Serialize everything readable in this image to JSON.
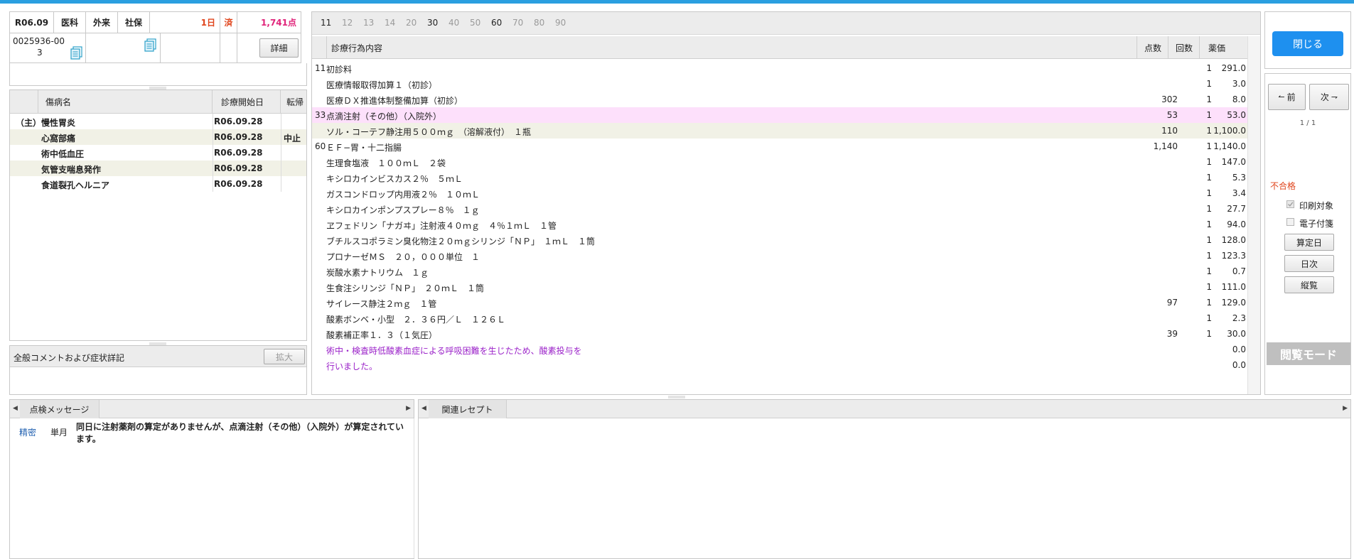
{
  "patient": {
    "era_date": "R06.09",
    "dept": "医科",
    "visit_type": "外来",
    "insurance": "社保",
    "days": "1日",
    "status": "済",
    "points": "1,741点",
    "id": "0025936-00",
    "id_suffix": "3",
    "detail_label": "詳細"
  },
  "disease_table": {
    "headers": [
      "傷病名",
      "診療開始日",
      "転帰"
    ],
    "rows": [
      {
        "mark": "（主）",
        "name": "慢性胃炎",
        "date": "R06.09.28",
        "outcome": ""
      },
      {
        "mark": "",
        "name": "心窩部痛",
        "date": "R06.09.28",
        "outcome": "中止"
      },
      {
        "mark": "",
        "name": "術中低血圧",
        "date": "R06.09.28",
        "outcome": ""
      },
      {
        "mark": "",
        "name": "気管支喘息発作",
        "date": "R06.09.28",
        "outcome": ""
      },
      {
        "mark": "",
        "name": "食道裂孔ヘルニア",
        "date": "R06.09.28",
        "outcome": ""
      }
    ]
  },
  "comment": {
    "label": "全般コメントおよび症状詳記",
    "expand_label": "拡大"
  },
  "procedure": {
    "tabs": [
      "11",
      "12",
      "13",
      "14",
      "20",
      "30",
      "40",
      "50",
      "60",
      "70",
      "80",
      "90"
    ],
    "active_tabs": [
      "11",
      "30",
      "60"
    ],
    "headers": {
      "content": "診療行為内容",
      "points": "点数",
      "count": "回数",
      "price": "薬価"
    },
    "rows": [
      {
        "code": "11",
        "text": "初診料",
        "points": "",
        "count": "1",
        "price": "291.0",
        "style": ""
      },
      {
        "code": "",
        "text": "医療情報取得加算１（初診）",
        "points": "",
        "count": "1",
        "price": "3.0",
        "style": ""
      },
      {
        "code": "",
        "text": "医療ＤＸ推進体制整備加算（初診）",
        "points": "302",
        "count": "1",
        "price": "8.0",
        "style": ""
      },
      {
        "code": "33",
        "text": "点滴注射（その他）（入院外）",
        "points": "53",
        "count": "1",
        "price": "53.0",
        "style": "pink"
      },
      {
        "code": "",
        "text": "ソル・コーテフ静注用５００ｍｇ　（溶解液付）　１瓶",
        "points": "110",
        "count": "1",
        "price": "1,100.0",
        "style": "beige"
      },
      {
        "code": "60",
        "text": "ＥＦ−胃・十二指腸",
        "points": "1,140",
        "count": "1",
        "price": "1,140.0",
        "style": ""
      },
      {
        "code": "",
        "text": "生理食塩液　１００ｍＬ　２袋",
        "points": "",
        "count": "1",
        "price": "147.0",
        "style": ""
      },
      {
        "code": "",
        "text": "キシロカインビスカス２％　５ｍＬ",
        "points": "",
        "count": "1",
        "price": "5.3",
        "style": ""
      },
      {
        "code": "",
        "text": "ガスコンドロップ内用液２％　１０ｍＬ",
        "points": "",
        "count": "1",
        "price": "3.4",
        "style": ""
      },
      {
        "code": "",
        "text": "キシロカインポンプスプレー８％　１ｇ",
        "points": "",
        "count": "1",
        "price": "27.7",
        "style": ""
      },
      {
        "code": "",
        "text": "ヱフェドリン「ナガヰ」注射液４０ｍｇ　４％１ｍＬ　１管",
        "points": "",
        "count": "1",
        "price": "94.0",
        "style": ""
      },
      {
        "code": "",
        "text": "ブチルスコポラミン臭化物注２０ｍｇシリンジ「ＮＰ」　１ｍＬ　１筒",
        "points": "",
        "count": "1",
        "price": "128.0",
        "style": ""
      },
      {
        "code": "",
        "text": "プロナーゼＭＳ　２０，０００単位　１",
        "points": "",
        "count": "1",
        "price": "123.3",
        "style": ""
      },
      {
        "code": "",
        "text": "炭酸水素ナトリウム　１ｇ",
        "points": "",
        "count": "1",
        "price": "0.7",
        "style": ""
      },
      {
        "code": "",
        "text": "生食注シリンジ「ＮＰ」　２０ｍＬ　１筒",
        "points": "",
        "count": "1",
        "price": "111.0",
        "style": ""
      },
      {
        "code": "",
        "text": "サイレース静注２ｍｇ　１管",
        "points": "97",
        "count": "1",
        "price": "129.0",
        "style": ""
      },
      {
        "code": "",
        "text": "酸素ボンベ・小型　２．３６円／Ｌ　１２６Ｌ",
        "points": "",
        "count": "1",
        "price": "2.3",
        "style": ""
      },
      {
        "code": "",
        "text": "酸素補正率１．３（１気圧）",
        "points": "39",
        "count": "1",
        "price": "30.0",
        "style": ""
      },
      {
        "code": "",
        "text": "術中・検査時低酸素血症による呼吸困難を生じたため、酸素投与を",
        "points": "",
        "count": "",
        "price": "0.0",
        "style": "comment"
      },
      {
        "code": "",
        "text": "行いました。",
        "points": "",
        "count": "",
        "price": "0.0",
        "style": "comment"
      }
    ]
  },
  "nav": {
    "close_label": "閉じる",
    "prev_label": "前",
    "next_label": "次",
    "page": "1 / 1",
    "fail_label": "不合格",
    "print_label": "印刷対象",
    "esign_label": "電子付箋",
    "calc_date_label": "算定日",
    "daily_label": "日次",
    "vertical_label": "縦覧",
    "mode_label": "閲覧モード"
  },
  "messages": {
    "tab_label": "点検メッセージ",
    "rows": [
      {
        "level": "精密",
        "scope": "単月",
        "text": "同日に注射薬剤の算定がありませんが、点滴注射（その他）（入院外）が算定されています。"
      }
    ]
  },
  "related": {
    "tab_label": "関連レセプト"
  },
  "colors": {
    "accent": "#1e90ef",
    "topbar": "#2a9fe0",
    "days": "#e0461e",
    "points": "#e0247a",
    "fail": "#e0461e",
    "comment": "#9b22c9",
    "pink_row": "#fde0fb",
    "beige_row": "#f1f1e6"
  }
}
